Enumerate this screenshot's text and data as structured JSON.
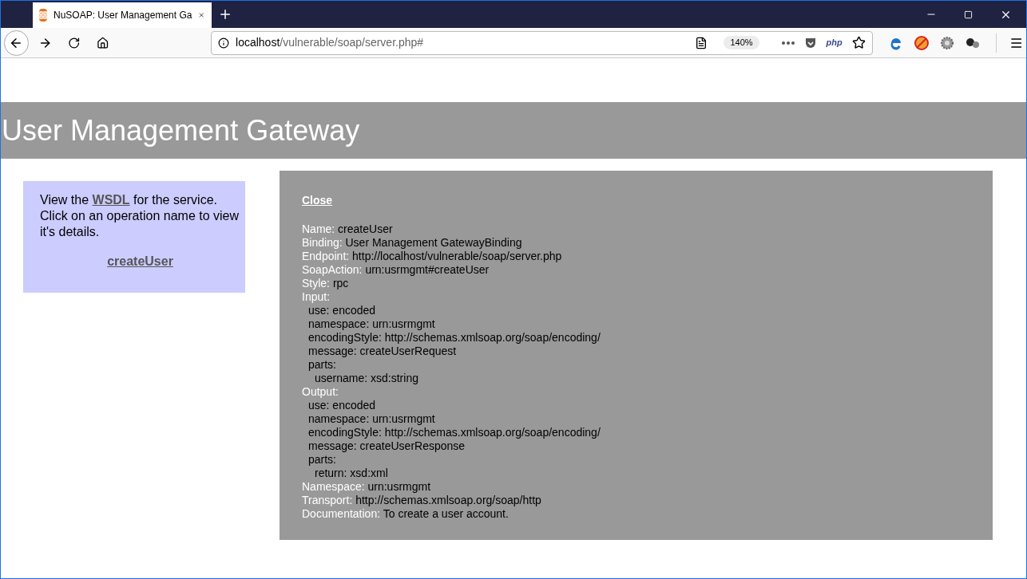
{
  "browser": {
    "tab": {
      "title": "NuSOAP: User Management Ga",
      "selected": true
    },
    "url": {
      "host": "localhost",
      "path": "/vulnerable/soap/server.php#"
    },
    "zoom": "140%",
    "php_label": "php"
  },
  "page": {
    "title": "User Management Gateway",
    "sidebar": {
      "intro_before": "View the ",
      "wsdl_link": "WSDL",
      "intro_after": " for the service. Click on an operation name to view it's details.",
      "operations": [
        "createUser"
      ]
    },
    "details": {
      "close": "Close",
      "fields": [
        {
          "label": "Name:",
          "value": "createUser"
        },
        {
          "label": "Binding:",
          "value": "User Management GatewayBinding"
        },
        {
          "label": "Endpoint:",
          "value": "http://localhost/vulnerable/soap/server.php"
        },
        {
          "label": "SoapAction:",
          "value": "urn:usrmgmt#createUser"
        },
        {
          "label": "Style:",
          "value": "rpc"
        },
        {
          "label": "Input:",
          "children": [
            {
              "label": "use:",
              "value": "encoded"
            },
            {
              "label": "namespace:",
              "value": "urn:usrmgmt"
            },
            {
              "label": "encodingStyle:",
              "value": "http://schemas.xmlsoap.org/soap/encoding/"
            },
            {
              "label": "message:",
              "value": "createUserRequest"
            },
            {
              "label": "parts:",
              "children": [
                {
                  "label": "username:",
                  "value": "xsd:string"
                }
              ]
            }
          ]
        },
        {
          "label": "Output:",
          "children": [
            {
              "label": "use:",
              "value": "encoded"
            },
            {
              "label": "namespace:",
              "value": "urn:usrmgmt"
            },
            {
              "label": "encodingStyle:",
              "value": "http://schemas.xmlsoap.org/soap/encoding/"
            },
            {
              "label": "message:",
              "value": "createUserResponse"
            },
            {
              "label": "parts:",
              "children": [
                {
                  "label": "return:",
                  "value": "xsd:xml"
                }
              ]
            }
          ]
        },
        {
          "label": "Namespace:",
          "value": "urn:usrmgmt"
        },
        {
          "label": "Transport:",
          "value": "http://schemas.xmlsoap.org/soap/http"
        },
        {
          "label": "Documentation:",
          "value": "To create a user account."
        }
      ]
    }
  }
}
